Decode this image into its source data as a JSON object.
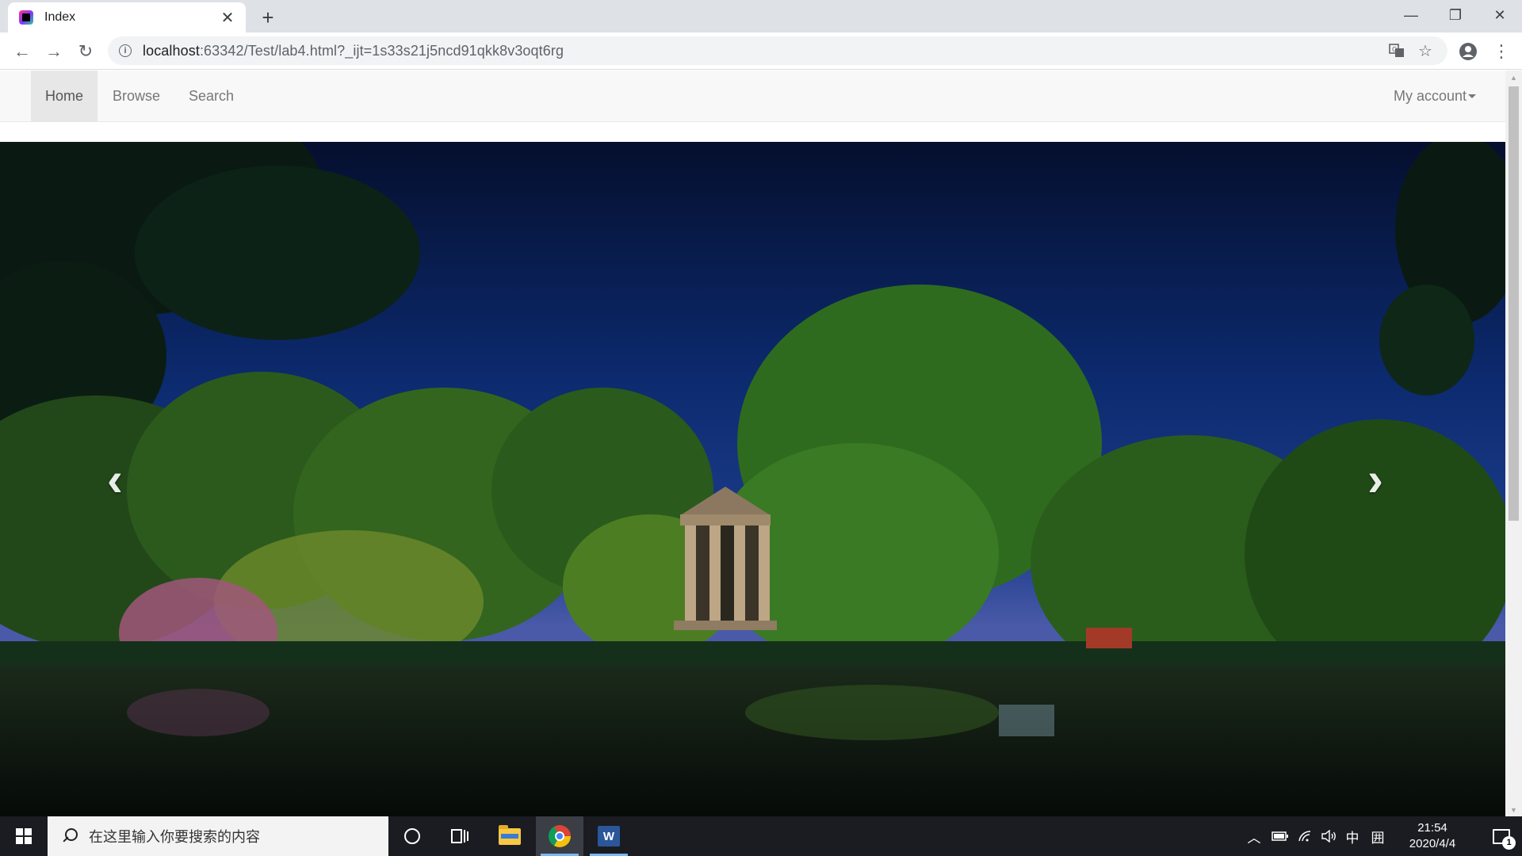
{
  "browser": {
    "tab_title": "Index",
    "new_tab_symbol": "+",
    "url_host": "localhost",
    "url_rest": ":63342/Test/lab4.html?_ijt=1s33s21j5ncd91qkk8v3oqt6rg",
    "accent": "#dee1e6"
  },
  "site": {
    "nav": {
      "items": [
        {
          "label": "Home",
          "active": true
        },
        {
          "label": "Browse",
          "active": false
        },
        {
          "label": "Search",
          "active": false
        }
      ],
      "account_label": "My account"
    },
    "carousel": {
      "prev_symbol": "‹",
      "next_symbol": "›",
      "image_description": "night-sky park scene with a classical temple among trees reflected in a lake",
      "sky_color": "#0d2a6b",
      "foliage_color": "#2f6b1f"
    }
  },
  "taskbar": {
    "search_placeholder": "在这里输入你要搜索的内容",
    "word_letter": "W",
    "tray": {
      "ime_label": "中",
      "layout_label": "囲"
    },
    "clock": {
      "time": "21:54",
      "date": "2020/4/4"
    },
    "notification_count": "1"
  }
}
